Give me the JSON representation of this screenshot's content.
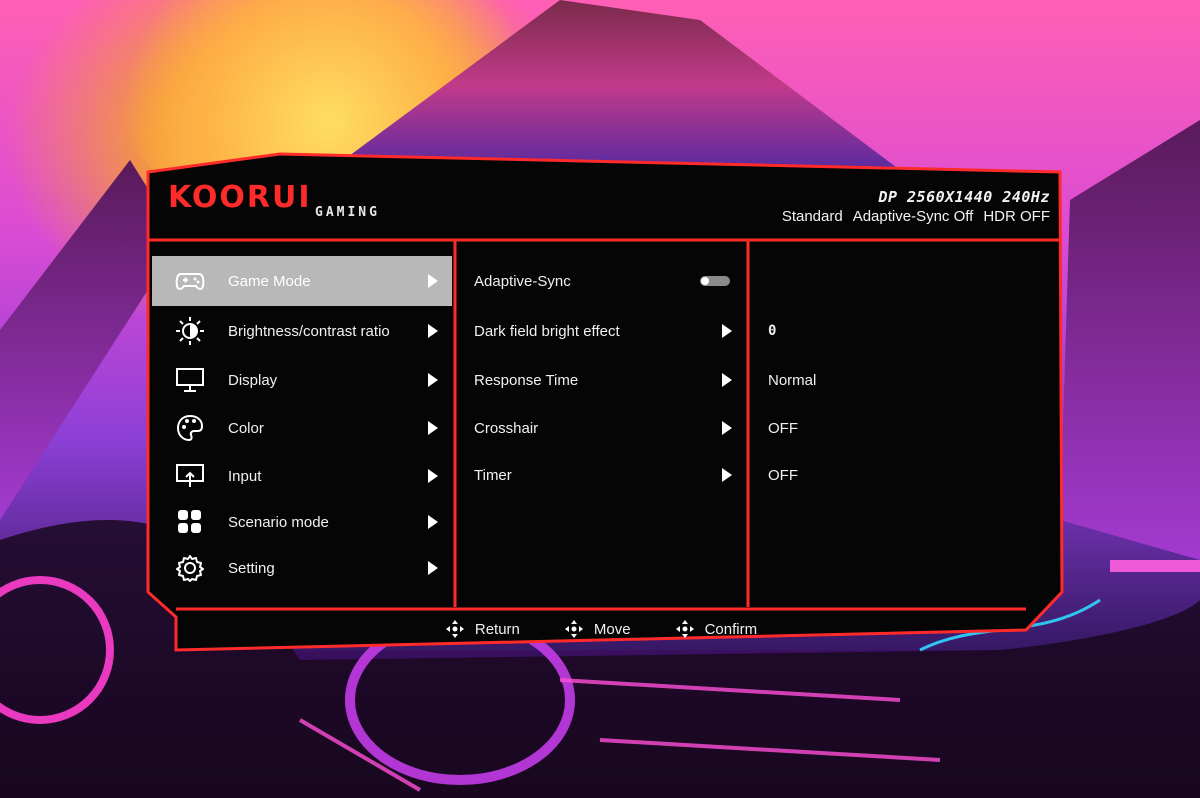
{
  "brand": {
    "name": "KOORUI",
    "subtitle": "GAMING"
  },
  "signal": {
    "line1": "DP 2560X1440 240Hz",
    "preset": "Standard",
    "adaptive_sync": "Adaptive-Sync Off",
    "hdr": "HDR OFF"
  },
  "main_menu": {
    "selected_index": 0,
    "items": [
      {
        "label": "Game Mode",
        "icon": "gamepad-icon"
      },
      {
        "label": "Brightness/contrast ratio",
        "icon": "brightness-icon"
      },
      {
        "label": "Display",
        "icon": "monitor-icon"
      },
      {
        "label": "Color",
        "icon": "palette-icon"
      },
      {
        "label": "Input",
        "icon": "input-icon"
      },
      {
        "label": "Scenario mode",
        "icon": "grid-icon"
      },
      {
        "label": "Setting",
        "icon": "gear-icon"
      }
    ]
  },
  "sub_menu": {
    "items": [
      {
        "label": "Adaptive-Sync",
        "control": "toggle",
        "toggle_on": false
      },
      {
        "label": "Dark field bright effect",
        "control": "arrow"
      },
      {
        "label": "Response Time",
        "control": "arrow"
      },
      {
        "label": "Crosshair",
        "control": "arrow"
      },
      {
        "label": "Timer",
        "control": "arrow"
      }
    ]
  },
  "values": {
    "dark_field": "0",
    "response_time": "Normal",
    "crosshair": "OFF",
    "timer": "OFF"
  },
  "footer": {
    "return_label": "Return",
    "move_label": "Move",
    "confirm_label": "Confirm"
  },
  "colors": {
    "accent_red": "#ff2b2b",
    "panel_bg": "#050505",
    "selected_bg": "#b8b8b8"
  }
}
